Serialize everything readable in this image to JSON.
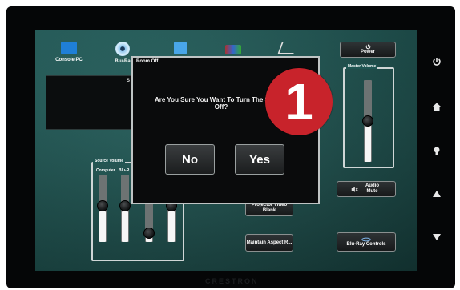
{
  "sources": [
    {
      "label": "Console PC",
      "icon": "monitor-icon"
    },
    {
      "label": "Blu-Ra",
      "icon": "disc-icon"
    },
    {
      "label": "",
      "icon": "tablet-icon"
    },
    {
      "label": "",
      "icon": "video-icon"
    },
    {
      "label": "",
      "icon": "document-camera-icon"
    }
  ],
  "display_box_label": "S",
  "source_volume": {
    "title": "Source Volume",
    "channels": [
      {
        "label": "Computer",
        "level": 0.55
      },
      {
        "label": "Blu-R",
        "level": 0.55
      },
      {
        "label": "",
        "level": 0.25
      },
      {
        "label": "",
        "level": 0.6
      }
    ]
  },
  "power_label": "Power",
  "master_volume": {
    "title": "Master Volume",
    "level": 0.62
  },
  "audio_mute_label": "Audio Mute",
  "projector_video_blank_label": "Projector Video Blank",
  "maintain_aspect_label": "Maintain Aspect R...",
  "bluray_controls_label": "Blu-Ray Controls",
  "modal": {
    "title": "Room Off",
    "message": "Are You Sure You Want To Turn The System Off?",
    "no_label": "No",
    "yes_label": "Yes"
  },
  "step_badge": "1",
  "brand": "CRESTRON",
  "colors": {
    "screen": "#1f5552",
    "badge": "#c8232b"
  }
}
